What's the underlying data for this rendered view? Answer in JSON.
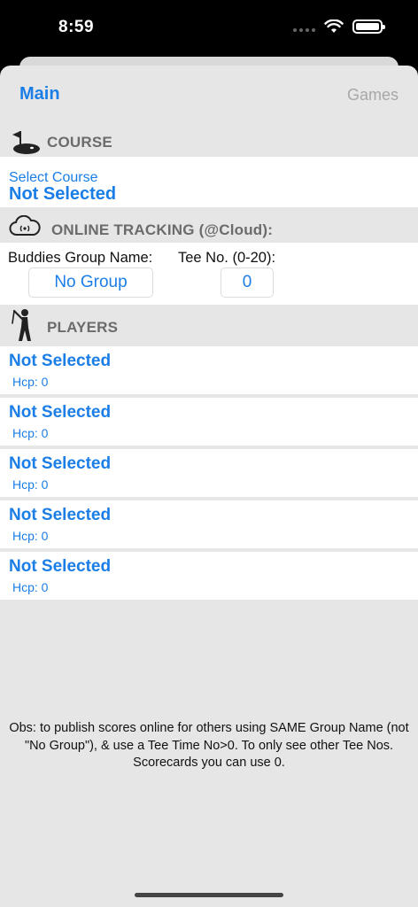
{
  "status": {
    "time": "8:59"
  },
  "nav": {
    "main_label": "Main",
    "games_label": "Games"
  },
  "course": {
    "header": "COURSE",
    "select_label": "Select Course",
    "value": "Not Selected"
  },
  "tracking": {
    "header": "ONLINE TRACKING (@Cloud):",
    "group_label": "Buddies Group Name:",
    "tee_label": "Tee No. (0-20):",
    "group_value": "No Group",
    "tee_value": "0"
  },
  "players": {
    "header": "PLAYERS",
    "items": [
      {
        "name": "Not Selected",
        "hcp": "Hcp: 0"
      },
      {
        "name": "Not Selected",
        "hcp": "Hcp: 0"
      },
      {
        "name": "Not Selected",
        "hcp": "Hcp: 0"
      },
      {
        "name": "Not Selected",
        "hcp": "Hcp: 0"
      },
      {
        "name": "Not Selected",
        "hcp": "Hcp: 0"
      }
    ]
  },
  "note": "Obs: to publish scores online for others using SAME Group Name (not \"No Group\"), & use a Tee Time No>0. To only see other Tee Nos. Scorecards you can use 0.",
  "colors": {
    "accent": "#1a7ee6",
    "background": "#e6e6e6",
    "header_text": "#6b6b6b"
  }
}
